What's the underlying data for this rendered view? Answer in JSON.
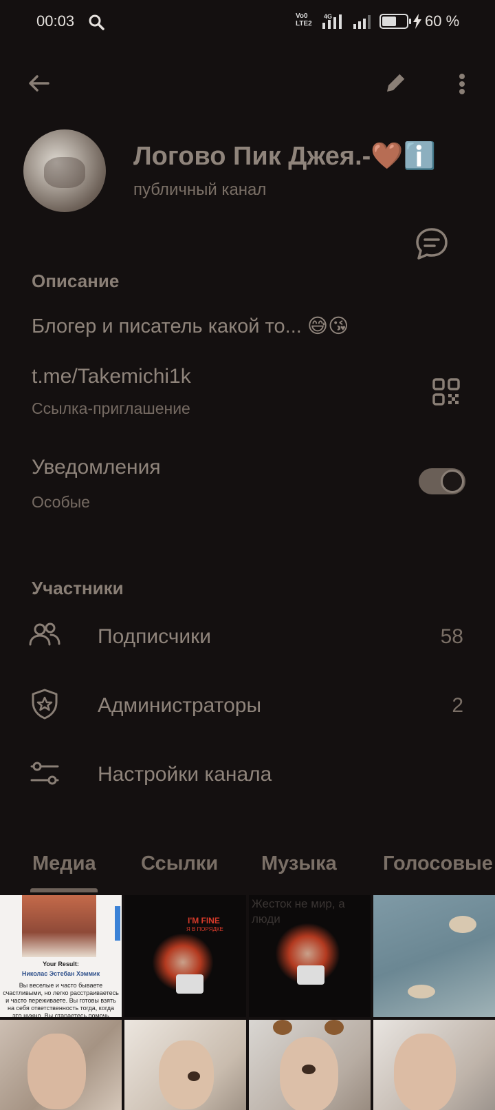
{
  "status_bar": {
    "time": "00:03",
    "net_label_1": "Vo0",
    "net_label_2": "LTE2",
    "net_4g": "4G",
    "battery_percent": 60,
    "battery_label": "60 %"
  },
  "toolbar": {
    "back_icon": "arrow-left-icon",
    "edit_icon": "pencil-icon",
    "more_icon": "more-vertical-icon"
  },
  "profile": {
    "title": "Логово Пик Джея.-🤎ℹ️",
    "subtitle": "публичный канал"
  },
  "description": {
    "heading": "Описание",
    "text": "Блогер и писатель какой то... 😅😘"
  },
  "invite": {
    "link": "t.me/Takemichi1k",
    "label": "Ссылка-приглашение"
  },
  "notifications": {
    "label": "Уведомления",
    "value": "Особые",
    "enabled": true
  },
  "members": {
    "heading": "Участники",
    "rows": [
      {
        "label": "Подписчики",
        "count": "58",
        "icon": "people-icon"
      },
      {
        "label": "Администраторы",
        "count": "2",
        "icon": "shield-star-icon"
      },
      {
        "label": "Настройки канала",
        "count": "",
        "icon": "sliders-icon"
      }
    ]
  },
  "tabs": [
    {
      "label": "Медиа",
      "active": true
    },
    {
      "label": "Ссылки",
      "active": false
    },
    {
      "label": "Музыка",
      "active": false
    },
    {
      "label": "Голосовые",
      "active": false
    }
  ],
  "media": {
    "cell1_title": "Your Result:",
    "cell1_name": "Николас Эстебан Хэммик",
    "cell1_body": "Вы веселые и часто бываете счастливыми, но легко расстраиваетесь и часто переживаете. Вы готовы взять на себя ответственность тогда, когда это нужно. Вы стараетесь помочь людям. Вы не против услужить за это",
    "cell2_caption_1": "I'M FINE",
    "cell2_caption_2": "Я В ПОРЯДКЕ",
    "cell3_caption": "Жесток не мир, а люди"
  }
}
